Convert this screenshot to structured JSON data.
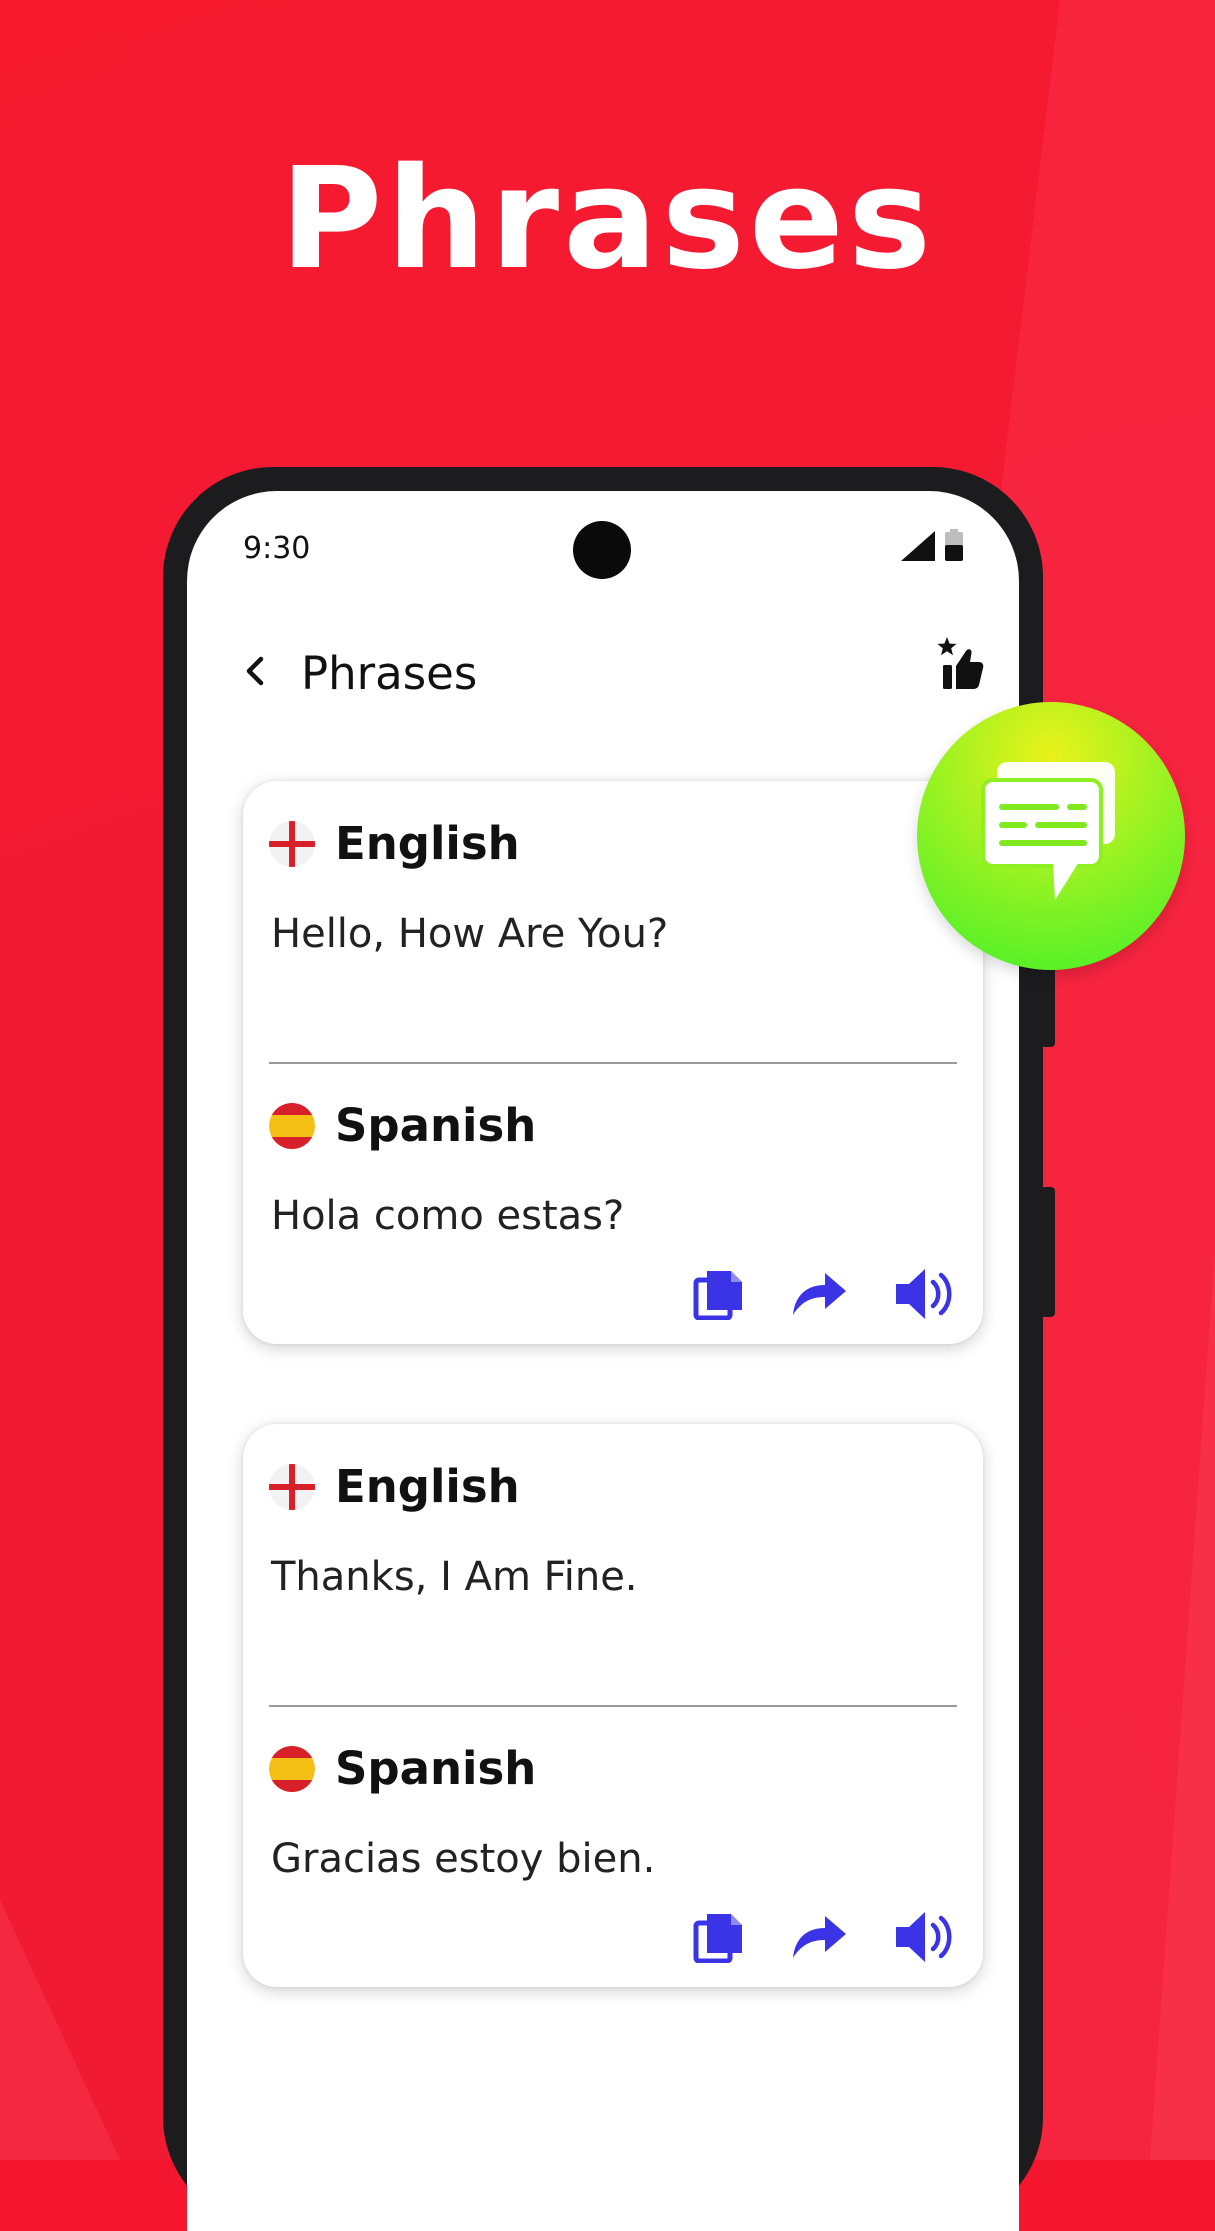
{
  "promo": {
    "headline": "Phrases"
  },
  "status_bar": {
    "time": "9:30"
  },
  "topbar": {
    "title": "Phrases"
  },
  "cards": [
    {
      "source_language": "English",
      "source_text": "Hello, How Are You?",
      "target_language": "Spanish",
      "target_text": "Hola como estas?"
    },
    {
      "source_language": "English",
      "source_text": "Thanks, I Am Fine.",
      "target_language": "Spanish",
      "target_text": "Gracias estoy bien."
    }
  ],
  "icons": {
    "back": "chevron-left-icon",
    "rate": "star-thumbs-up-icon",
    "copy": "copy-icon",
    "share": "share-icon",
    "speak": "speaker-icon",
    "badge": "chat-bubbles-icon"
  },
  "colors": {
    "background": "#f3162e",
    "action_icons": "#3a34e6",
    "badge_top": "#e9f21a",
    "badge_bottom": "#3ff02a",
    "phone_frame": "#1c1c1e"
  }
}
